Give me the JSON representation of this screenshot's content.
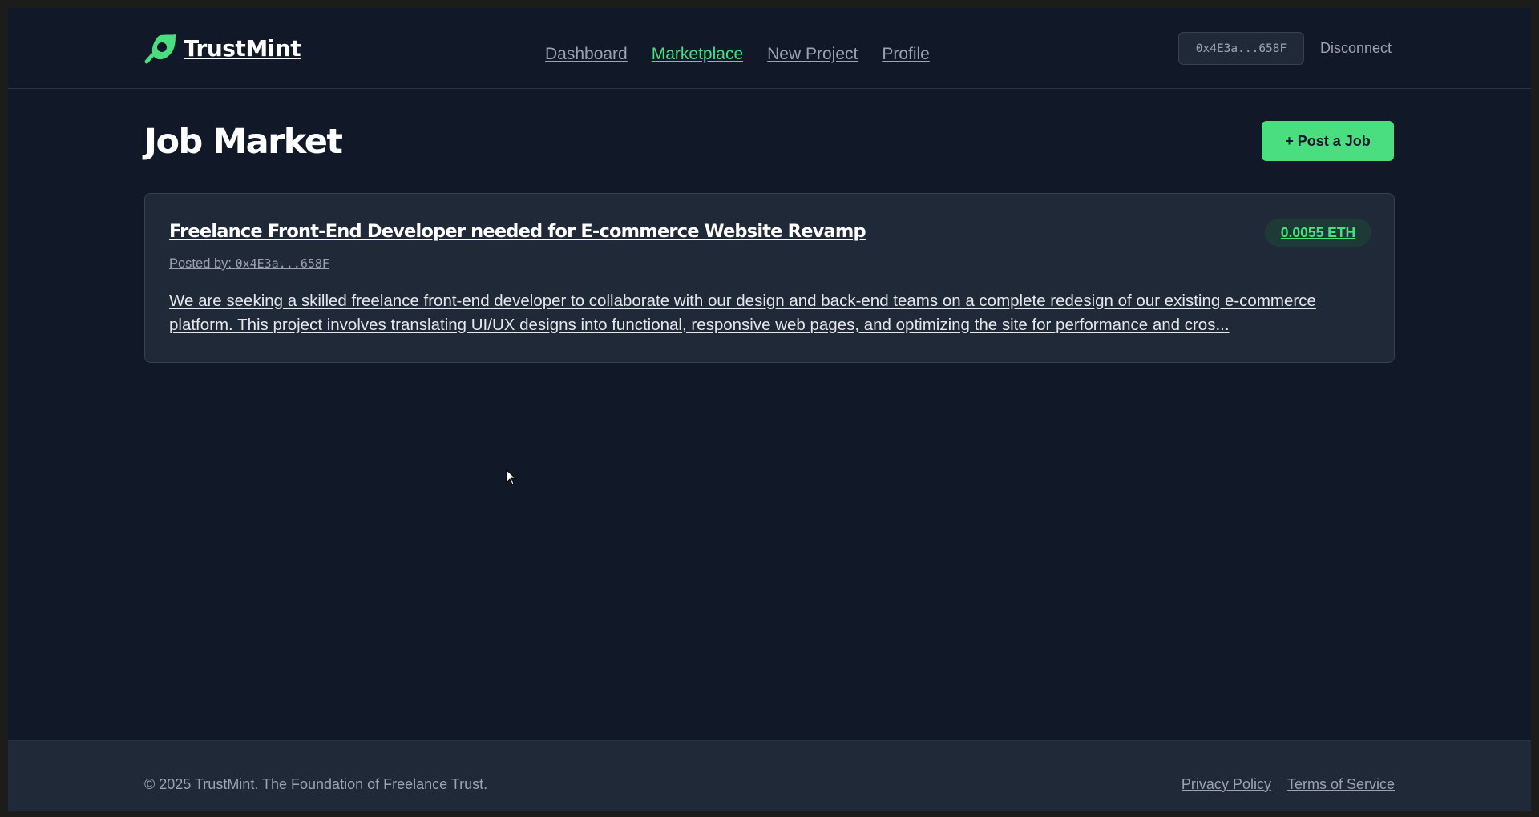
{
  "brand": {
    "name": "TrustMint",
    "icon": "leaf-magnifier-icon",
    "accent_color": "#4ade80"
  },
  "nav": {
    "items": [
      {
        "label": "Dashboard",
        "active": false
      },
      {
        "label": "Marketplace",
        "active": true
      },
      {
        "label": "New Project",
        "active": false
      },
      {
        "label": "Profile",
        "active": false
      }
    ]
  },
  "wallet": {
    "address": "0x4E3a...658F",
    "disconnect_label": "Disconnect"
  },
  "main": {
    "title": "Job Market",
    "post_button_label": "+ Post a Job",
    "jobs": [
      {
        "title": "Freelance Front-End Developer needed for E-commerce Website Revamp",
        "price": "0.0055 ETH",
        "posted_by_label": "Posted by:",
        "posted_by_address": "0x4E3a...658F",
        "description": "We are seeking a skilled freelance front-end developer to collaborate with our design and back-end teams on a complete redesign of our existing e-commerce platform. This project involves translating UI/UX designs into functional, responsive web pages, and optimizing the site for performance and cros..."
      }
    ]
  },
  "footer": {
    "copyright": "© 2025 TrustMint. The Foundation of Freelance Trust.",
    "links": [
      "Privacy Policy",
      "Terms of Service"
    ]
  }
}
